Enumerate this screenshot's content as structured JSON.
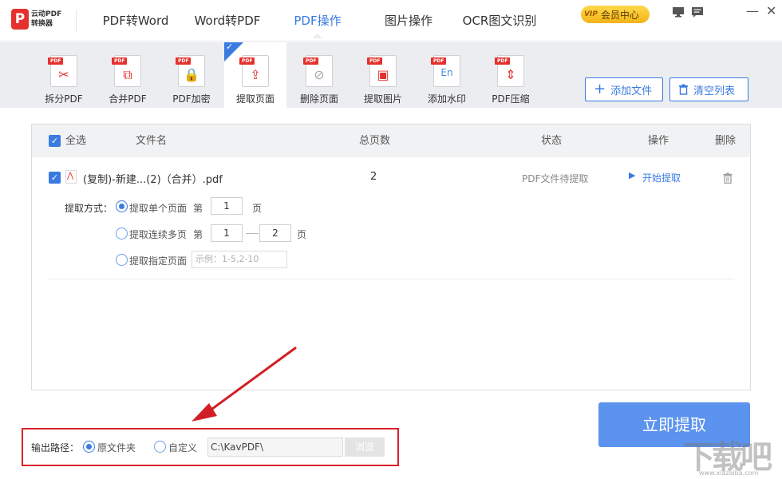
{
  "app": {
    "logo_mark": "P",
    "logo_line1": "云动PDF",
    "logo_line2": "转换器"
  },
  "nav": {
    "tabs": [
      {
        "label": "PDF转Word"
      },
      {
        "label": "Word转PDF"
      },
      {
        "label": "PDF操作"
      },
      {
        "label": "图片操作"
      },
      {
        "label": "OCR图文识别"
      }
    ],
    "active_index": 2,
    "vip_badge": "VIP",
    "vip_label": "会员中心"
  },
  "toolbar": {
    "tools": [
      {
        "label": "拆分PDF",
        "icon": "split-pdf-icon",
        "glyph": "✂"
      },
      {
        "label": "合并PDF",
        "icon": "merge-pdf-icon",
        "glyph": "⧉"
      },
      {
        "label": "PDF加密",
        "icon": "encrypt-pdf-icon",
        "glyph": "🔒"
      },
      {
        "label": "提取页面",
        "icon": "extract-page-icon",
        "glyph": "⇪"
      },
      {
        "label": "删除页面",
        "icon": "delete-page-icon",
        "glyph": "⊘"
      },
      {
        "label": "提取图片",
        "icon": "extract-image-icon",
        "glyph": "▣"
      },
      {
        "label": "添加水印",
        "icon": "watermark-icon",
        "glyph": "En"
      },
      {
        "label": "PDF压缩",
        "icon": "compress-pdf-icon",
        "glyph": "⇕"
      }
    ],
    "pdf_tag": "PDF",
    "active_index": 3,
    "add_file": "添加文件",
    "clear_list": "清空列表"
  },
  "table": {
    "headers": {
      "select_all": "全选",
      "filename": "文件名",
      "pages": "总页数",
      "status": "状态",
      "action": "操作",
      "delete": "删除"
    },
    "rows": [
      {
        "filename": "(复制)-新建...(2)（合并）.pdf",
        "pages": "2",
        "status": "PDF文件待提取",
        "action": "开始提取"
      }
    ],
    "extract": {
      "mode_label": "提取方式：",
      "single_label": "提取单个页面",
      "range_label": "提取连续多页",
      "custom_label": "提取指定页面",
      "prefix": "第",
      "suffix": "页",
      "single_page": "1",
      "range_from": "1",
      "range_to": "2",
      "custom_placeholder": "示例：1-5,2-10",
      "selected": "single"
    }
  },
  "output": {
    "label": "输出路径：",
    "original_folder": "原文件夹",
    "custom": "自定义",
    "path": "C:\\KavPDF\\",
    "browse": "浏览",
    "selected": "original"
  },
  "action": {
    "extract_now": "立即提取"
  },
  "watermark": {
    "text": "下载吧",
    "url": "www.xiazaiba.com"
  },
  "colors": {
    "accent": "#3a7be0",
    "primary_button": "#5b93ee",
    "brand_red": "#e4312b",
    "highlight_border": "#d9202a",
    "arrow": "#d21f26"
  }
}
